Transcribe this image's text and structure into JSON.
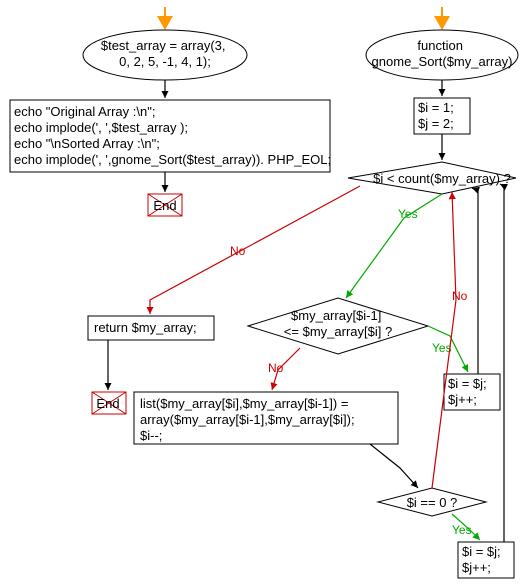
{
  "chart_data": {
    "type": "flowchart",
    "left": {
      "entry_arrow_color": "orange",
      "start_ellipse": "$test_array = array(3,\n0, 2, 5, -1, 4, 1);",
      "stmt_block": [
        "echo \"Original Array :\\n\";",
        "echo implode(', ',$test_array );",
        "echo \"\\nSorted Array :\\n\";",
        "echo implode(', ',gnome_Sort($test_array)). PHP_EOL;"
      ],
      "end_label": "End"
    },
    "right": {
      "entry_arrow_color": "orange",
      "func_ellipse": "function\ngnome_Sort($my_array)",
      "init_block": [
        "$i = 1;",
        "$j = 2;"
      ],
      "cond1": "$i < count($my_array) ?",
      "cond1_yes": "Yes",
      "cond1_no": "No",
      "return_block": "return $my_array;",
      "end_label": "End",
      "cond2": "$my_array[$i-1]\n<= $my_array[$i] ?",
      "cond2_yes": "Yes",
      "cond2_no": "No",
      "swap_block": "list($my_array[$i],$my_array[$i-1]) =\narray($my_array[$i-1],$my_array[$i]);\n$i--;",
      "assign_block": [
        "$i = $j;",
        "$j++;"
      ],
      "cond3": "$i == 0 ?",
      "cond3_yes": "Yes",
      "cond3_no": "No",
      "assign_block2": [
        "$i = $j;",
        "$j++;"
      ]
    }
  }
}
